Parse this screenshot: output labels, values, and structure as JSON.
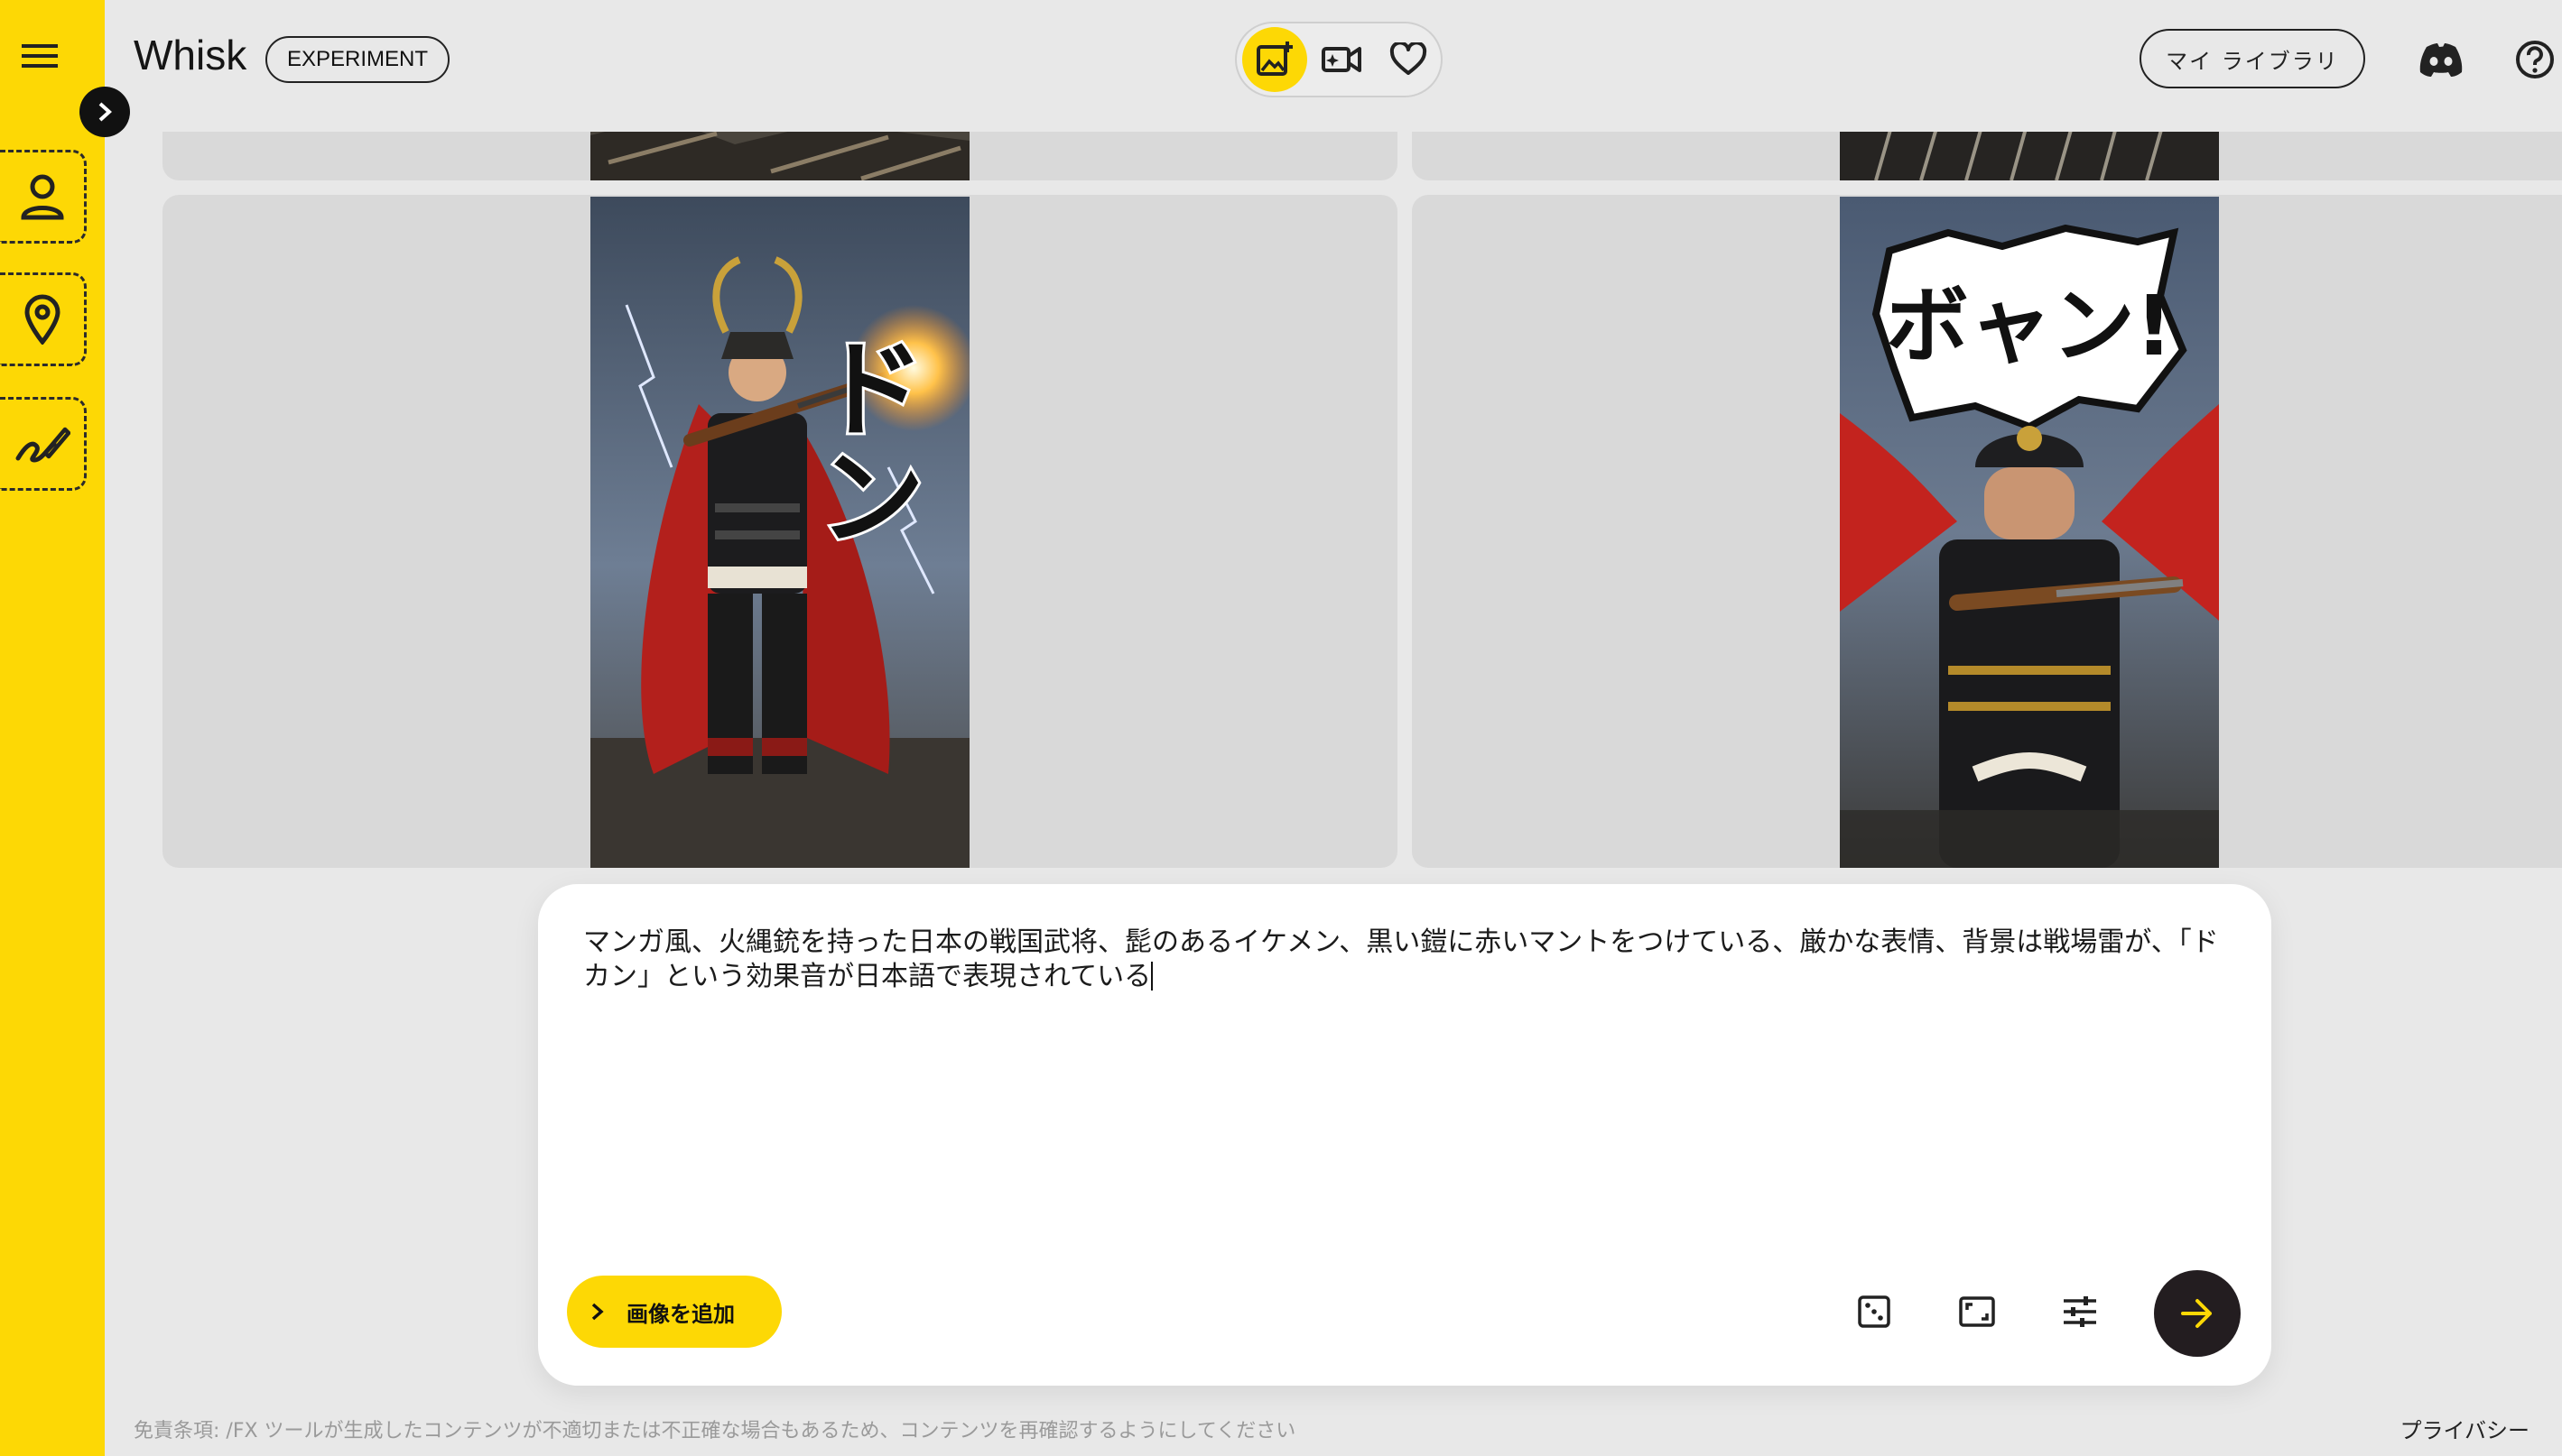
{
  "app": {
    "title": "Whisk",
    "badge": "EXPERIMENT"
  },
  "header": {
    "modes": [
      {
        "name": "image-mode",
        "icon": "add-photo-icon",
        "active": true
      },
      {
        "name": "video-mode",
        "icon": "video-sparkle-icon",
        "active": false
      },
      {
        "name": "favorites",
        "icon": "heart-icon",
        "active": false
      }
    ],
    "library_label": "マイ ライブラリ",
    "discord_icon": "discord-icon",
    "help_icon": "help-icon"
  },
  "sidebar": {
    "slots": [
      {
        "name": "subject",
        "icon": "person-icon"
      },
      {
        "name": "scene",
        "icon": "location-pin-icon"
      },
      {
        "name": "style",
        "icon": "brush-style-icon"
      }
    ]
  },
  "gallery": {
    "images": [
      {
        "sfx": "ドン",
        "caption": "samurai-with-matchlock-1"
      },
      {
        "sfx": "ボャン!",
        "caption": "samurai-with-matchlock-2"
      }
    ]
  },
  "prompt": {
    "text": "マンガ風、火縄銃を持った日本の戦国武将、髭のあるイケメン、黒い鎧に赤いマントをつけている、厳かな表情、背景は戦場雷が、「ドカン」という効果音が日本語で表現されている",
    "add_image_label": "画像を追加"
  },
  "footer": {
    "disclaimer": "免責条項: /FX ツールが生成したコンテンツが不適切または不正確な場合もあるため、コンテンツを再確認するようにしてください",
    "privacy": "プライバシー"
  },
  "colors": {
    "accent": "#fdd805",
    "background": "#e8e8e8",
    "submit": "#231d20"
  }
}
